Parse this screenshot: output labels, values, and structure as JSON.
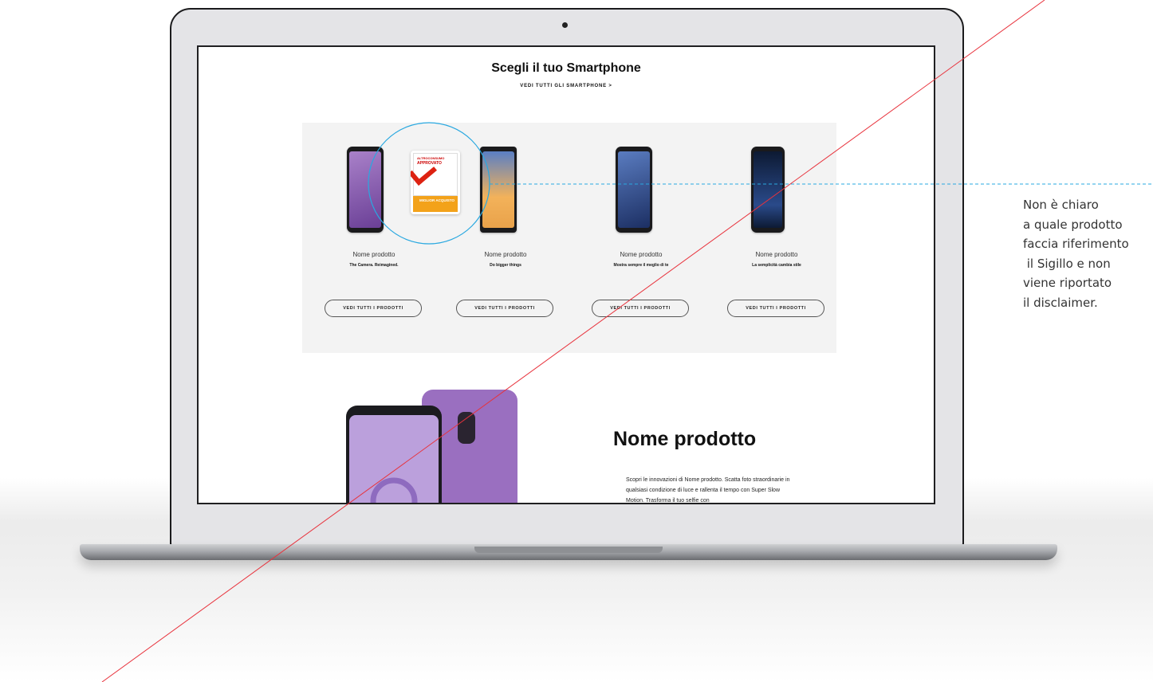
{
  "screen": {
    "section_title": "Scegli il tuo Smartphone",
    "see_all_link": "VEDI TUTTI GLI SMARTPHONE >",
    "products": [
      {
        "name": "Nome prodotto",
        "tagline": "The Camera. Reimagined.",
        "button": "VEDI TUTTI I PRODOTTI",
        "screen_color": "#7b4fa8"
      },
      {
        "name": "Nome prodotto",
        "tagline": "Do bigger things",
        "button": "VEDI TUTTI I PRODOTTI",
        "screen_color": "#f0a640"
      },
      {
        "name": "Nome prodotto",
        "tagline": "Mostra sempre il meglio di te",
        "button": "VEDI TUTTI I PRODOTTI",
        "screen_color": "#2e4a88"
      },
      {
        "name": "Nome prodotto",
        "tagline": "La semplicità cambia stile",
        "button": "VEDI TUTTI I PRODOTTI",
        "screen_color": "#1d3a6e"
      }
    ],
    "badge": {
      "brand": "ALTROCONSUMO",
      "status": "APPROVATO",
      "label": "MIGLIOR ACQUISTO"
    },
    "hero": {
      "title": "Nome prodotto",
      "description": "Scopri le innovazioni di Nome prodotto. Scatta foto straordinarie in qualsiasi condizione di luce e rallenta il tempo con Super Slow Motion. Trasforma il tuo selfie con"
    }
  },
  "annotation": {
    "lines": [
      "Non è chiaro",
      "a quale prodotto",
      "faccia riferimento",
      " il Sigillo e non",
      "viene riportato",
      "il disclaimer."
    ],
    "circle_color": "#29a8e0",
    "cross_line_color": "#e8323c"
  }
}
